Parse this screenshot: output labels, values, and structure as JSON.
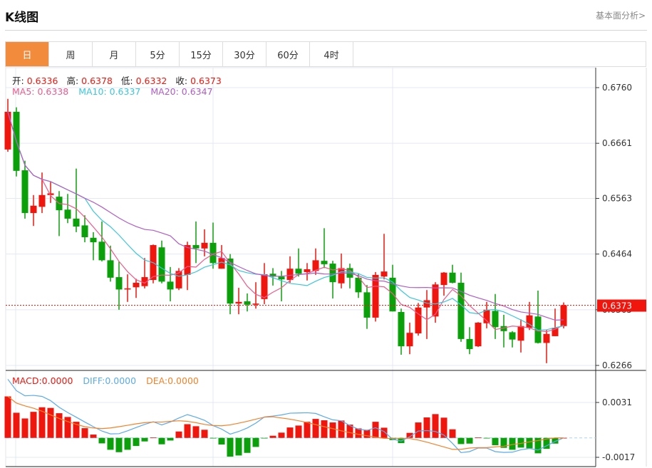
{
  "header": {
    "title": "K线图",
    "more_link": "基本面分析>"
  },
  "tabs": [
    {
      "label": "日",
      "active": true
    },
    {
      "label": "周"
    },
    {
      "label": "月"
    },
    {
      "label": "5分"
    },
    {
      "label": "15分"
    },
    {
      "label": "30分"
    },
    {
      "label": "60分"
    },
    {
      "label": "4时"
    }
  ],
  "ohlc_legend": {
    "open_label": "开:",
    "open": "0.6336",
    "high_label": "高:",
    "high": "0.6378",
    "low_label": "低:",
    "low": "0.6332",
    "close_label": "收:",
    "close": "0.6373"
  },
  "ma_legend": {
    "ma5": "MA5: 0.6338",
    "ma10": "MA10: 0.6337",
    "ma20": "MA20: 0.6347"
  },
  "macd_legend": {
    "macd": "MACD:0.0000",
    "diff": "DIFF:0.0000",
    "dea": "DEA:0.0000"
  },
  "colors": {
    "up": "#f0160e",
    "down": "#0aa00a",
    "ma5": "#ef5a8a",
    "ma10": "#3cc6dc",
    "ma20": "#b05cc8",
    "diff": "#5aaaf0",
    "dea": "#f5822a",
    "active_tab": "#f28b3c",
    "last_price": "#f0160e"
  },
  "chart_data": [
    {
      "type": "candlestick",
      "fields": [
        "open",
        "high",
        "low",
        "close"
      ],
      "ylim": [
        0.6266,
        0.676
      ],
      "y_ticks": [
        "0.6760",
        "0.6661",
        "0.6563",
        "0.6464",
        "0.6365",
        "0.6266"
      ],
      "last_price": "0.6373",
      "grid": true,
      "candles": [
        [
          0.665,
          0.674,
          0.6646,
          0.6717
        ],
        [
          0.6717,
          0.6725,
          0.6602,
          0.6612
        ],
        [
          0.6613,
          0.663,
          0.6527,
          0.6537
        ],
        [
          0.6537,
          0.6569,
          0.6514,
          0.655
        ],
        [
          0.6548,
          0.6609,
          0.6537,
          0.6569
        ],
        [
          0.6569,
          0.6593,
          0.6555,
          0.6572
        ],
        [
          0.6566,
          0.6576,
          0.6496,
          0.6542
        ],
        [
          0.6543,
          0.6571,
          0.6519,
          0.6527
        ],
        [
          0.6527,
          0.6616,
          0.6503,
          0.6513
        ],
        [
          0.6515,
          0.6533,
          0.6485,
          0.6494
        ],
        [
          0.6493,
          0.6503,
          0.6453,
          0.6485
        ],
        [
          0.6486,
          0.6522,
          0.6451,
          0.6453
        ],
        [
          0.6453,
          0.6479,
          0.6415,
          0.6422
        ],
        [
          0.6423,
          0.6451,
          0.6365,
          0.6401
        ],
        [
          0.6401,
          0.6428,
          0.6379,
          0.6403
        ],
        [
          0.6405,
          0.642,
          0.6386,
          0.6413
        ],
        [
          0.6407,
          0.6457,
          0.6403,
          0.6423
        ],
        [
          0.6418,
          0.6481,
          0.6412,
          0.648
        ],
        [
          0.6476,
          0.6488,
          0.6412,
          0.6415
        ],
        [
          0.6415,
          0.6441,
          0.638,
          0.6401
        ],
        [
          0.6403,
          0.6439,
          0.64,
          0.6434
        ],
        [
          0.6427,
          0.6486,
          0.64,
          0.648
        ],
        [
          0.648,
          0.6522,
          0.6448,
          0.6474
        ],
        [
          0.6474,
          0.6508,
          0.646,
          0.6484
        ],
        [
          0.6484,
          0.652,
          0.6438,
          0.6448
        ],
        [
          0.6438,
          0.648,
          0.6438,
          0.6457
        ],
        [
          0.6456,
          0.6464,
          0.6357,
          0.6376
        ],
        [
          0.6376,
          0.6404,
          0.6357,
          0.6379
        ],
        [
          0.638,
          0.6394,
          0.6362,
          0.6374
        ],
        [
          0.6374,
          0.6414,
          0.6367,
          0.6376
        ],
        [
          0.6384,
          0.6448,
          0.6375,
          0.6428
        ],
        [
          0.6429,
          0.6439,
          0.6408,
          0.6424
        ],
        [
          0.6424,
          0.6434,
          0.638,
          0.6419
        ],
        [
          0.6418,
          0.646,
          0.6413,
          0.6438
        ],
        [
          0.6438,
          0.6474,
          0.6424,
          0.6429
        ],
        [
          0.6432,
          0.6448,
          0.6417,
          0.6437
        ],
        [
          0.6434,
          0.6474,
          0.6427,
          0.6453
        ],
        [
          0.6452,
          0.651,
          0.6439,
          0.6446
        ],
        [
          0.6447,
          0.6452,
          0.6385,
          0.6414
        ],
        [
          0.6412,
          0.6465,
          0.6403,
          0.6439
        ],
        [
          0.6439,
          0.6447,
          0.6403,
          0.6422
        ],
        [
          0.6422,
          0.6429,
          0.6386,
          0.6396
        ],
        [
          0.6396,
          0.6409,
          0.6331,
          0.6351
        ],
        [
          0.6351,
          0.6432,
          0.6344,
          0.6427
        ],
        [
          0.6424,
          0.65,
          0.6419,
          0.6433
        ],
        [
          0.6422,
          0.6445,
          0.6362,
          0.6362
        ],
        [
          0.6361,
          0.6367,
          0.6285,
          0.63
        ],
        [
          0.63,
          0.6342,
          0.6286,
          0.6324
        ],
        [
          0.6323,
          0.6377,
          0.6319,
          0.6369
        ],
        [
          0.6369,
          0.64,
          0.6313,
          0.6382
        ],
        [
          0.6353,
          0.6414,
          0.6342,
          0.641
        ],
        [
          0.6409,
          0.6432,
          0.639,
          0.6431
        ],
        [
          0.6431,
          0.6445,
          0.6412,
          0.6413
        ],
        [
          0.6413,
          0.6431,
          0.6308,
          0.6313
        ],
        [
          0.6313,
          0.6334,
          0.6286,
          0.6295
        ],
        [
          0.63,
          0.6343,
          0.6299,
          0.6342
        ],
        [
          0.6341,
          0.6379,
          0.6332,
          0.6365
        ],
        [
          0.6363,
          0.6393,
          0.6313,
          0.6334
        ],
        [
          0.6336,
          0.6356,
          0.6298,
          0.6327
        ],
        [
          0.6325,
          0.6327,
          0.6298,
          0.6312
        ],
        [
          0.631,
          0.6348,
          0.6289,
          0.6336
        ],
        [
          0.6333,
          0.6379,
          0.6329,
          0.6355
        ],
        [
          0.6353,
          0.6399,
          0.6305,
          0.6306
        ],
        [
          0.6306,
          0.6329,
          0.627,
          0.6322
        ],
        [
          0.6318,
          0.6367,
          0.6318,
          0.6333
        ],
        [
          0.6336,
          0.6378,
          0.6332,
          0.6373
        ]
      ],
      "series": [
        {
          "name": "MA5",
          "period": 5
        },
        {
          "name": "MA10",
          "period": 10
        },
        {
          "name": "MA20",
          "period": 20
        }
      ]
    },
    {
      "type": "bar+line",
      "ylim": [
        -0.0017,
        0.0031
      ],
      "y_ticks": [
        "0.0031",
        "-0.0017"
      ],
      "macd": [
        0.00363,
        0.0022,
        0.0017,
        0.00228,
        0.00268,
        0.00262,
        0.00216,
        0.00183,
        0.00141,
        0.00085,
        0.00029,
        -0.00048,
        -0.00104,
        -0.00125,
        -0.00104,
        -0.00071,
        -0.00031,
        4e-05,
        -0.00056,
        -0.00023,
        0.00056,
        0.0012,
        0.00102,
        0.00071,
        -4e-05,
        -0.00058,
        -0.00164,
        -0.00154,
        -0.00131,
        -0.00079,
        -2e-05,
        0.00019,
        0.00046,
        0.00091,
        0.00108,
        0.00141,
        0.00166,
        0.00154,
        0.00135,
        0.00152,
        0.00116,
        0.00083,
        0.00071,
        0.00141,
        0.00089,
        -0.00019,
        -0.00046,
        0.00044,
        0.00135,
        0.00179,
        0.00208,
        0.00177,
        0.00075,
        -0.00054,
        -0.0005,
        4e-05,
        -4e-05,
        -0.00064,
        -0.00087,
        -0.00104,
        -0.00085,
        -0.00091,
        -0.00135,
        -0.00096,
        -0.0005,
        0
      ],
      "diff": [
        0.00513,
        0.00413,
        0.00368,
        0.00372,
        0.00363,
        0.00326,
        0.00268,
        0.00222,
        0.00181,
        0.00139,
        0.00098,
        0.0006,
        0.00035,
        0.00037,
        0.00062,
        0.00091,
        0.00118,
        0.00141,
        0.00114,
        0.00139,
        0.00174,
        0.00204,
        0.00181,
        0.00154,
        0.00108,
        0.00077,
        0.00033,
        0.00056,
        0.00087,
        0.00129,
        0.00183,
        0.00191,
        0.00201,
        0.00216,
        0.00218,
        0.0022,
        0.00214,
        0.00185,
        0.00158,
        0.0015,
        0.00108,
        0.00077,
        0.00066,
        0.00089,
        0.00056,
        -0.00012,
        -0.00027,
        0.0001,
        0.0006,
        0.00064,
        0.00056,
        0.00025,
        -0.00048,
        -0.00129,
        -0.0012,
        -0.00089,
        -0.00089,
        -0.0012,
        -0.00127,
        -0.00125,
        -0.00104,
        -0.00093,
        -0.00106,
        -0.00069,
        -0.00031,
        0
      ],
      "dea": [
        0.00363,
        0.00305,
        0.0028,
        0.0026,
        0.00233,
        0.00201,
        0.0017,
        0.00143,
        0.00118,
        0.00098,
        0.00087,
        0.00081,
        0.00087,
        0.00098,
        0.0011,
        0.00123,
        0.00133,
        0.00139,
        0.00139,
        0.00145,
        0.0015,
        0.00145,
        0.00133,
        0.00118,
        0.00108,
        0.00106,
        0.00114,
        0.00129,
        0.00145,
        0.00164,
        0.00181,
        0.00185,
        0.00174,
        0.00164,
        0.0015,
        0.00135,
        0.00116,
        0.00098,
        0.00081,
        0.00062,
        0.00046,
        0.00031,
        0.00019,
        6e-05,
        -4e-05,
        -6e-05,
        -6e-05,
        -6e-05,
        -0.00019,
        -0.00037,
        -0.00058,
        -0.00079,
        -0.001,
        -0.001,
        -0.00089,
        -0.00085,
        -0.00085,
        -0.00079,
        -0.00073,
        -0.00058,
        -0.00048,
        -0.00035,
        -0.00023,
        -0.0001,
        0,
        0
      ]
    }
  ]
}
